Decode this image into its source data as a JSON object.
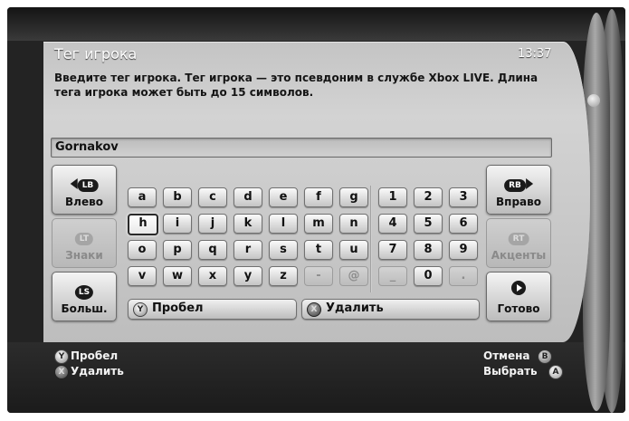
{
  "header": {
    "title": "Тег игрока",
    "time": "13:37"
  },
  "description": "Введите тег игрока. Тег игрока — это псевдоним в службе Xbox LIVE. Длина тега игрока может быть до 15 символов.",
  "gamertag_field": {
    "value": "Gornakov"
  },
  "side_buttons": {
    "left": [
      {
        "label": "Влево",
        "badge": "LB",
        "icon": "arrow-left-icon",
        "enabled": true
      },
      {
        "label": "Знаки",
        "badge": "LT",
        "icon": "lt-trigger-icon",
        "enabled": false
      },
      {
        "label": "Больш.",
        "badge": "LS",
        "icon": "left-stick-icon",
        "enabled": true
      }
    ],
    "right": [
      {
        "label": "Вправо",
        "badge": "RB",
        "icon": "arrow-right-icon",
        "enabled": true
      },
      {
        "label": "Акценты",
        "badge": "RT",
        "icon": "rt-trigger-icon",
        "enabled": false
      },
      {
        "label": "Готово",
        "icon": "play-icon",
        "enabled": true
      }
    ]
  },
  "keyboard": {
    "letters": [
      [
        "a",
        "b",
        "c",
        "d",
        "e",
        "f",
        "g"
      ],
      [
        "h",
        "i",
        "j",
        "k",
        "l",
        "m",
        "n"
      ],
      [
        "o",
        "p",
        "q",
        "r",
        "s",
        "t",
        "u"
      ],
      [
        "v",
        "w",
        "x",
        "y",
        "z",
        "-",
        "@"
      ]
    ],
    "digits": [
      [
        "1",
        "2",
        "3"
      ],
      [
        "4",
        "5",
        "6"
      ],
      [
        "7",
        "8",
        "9"
      ],
      [
        "_",
        "0",
        "."
      ]
    ],
    "selected_key": "h",
    "disabled_keys": [
      "-",
      "@",
      "_",
      "."
    ],
    "space_label": "Пробел",
    "delete_label": "Удалить",
    "space_button_badge": "Y",
    "delete_button_badge": "X"
  },
  "footer": {
    "left": [
      {
        "button": "Y",
        "label": "Пробел"
      },
      {
        "button": "X",
        "label": "Удалить"
      }
    ],
    "right": [
      {
        "button": "B",
        "label": "Отмена"
      },
      {
        "button": "A",
        "label": "Выбрать"
      }
    ]
  },
  "colors": {
    "panel": "#c8c8c8",
    "frame": "#232323",
    "text_dark": "#111111",
    "text_light": "#ffffff"
  }
}
